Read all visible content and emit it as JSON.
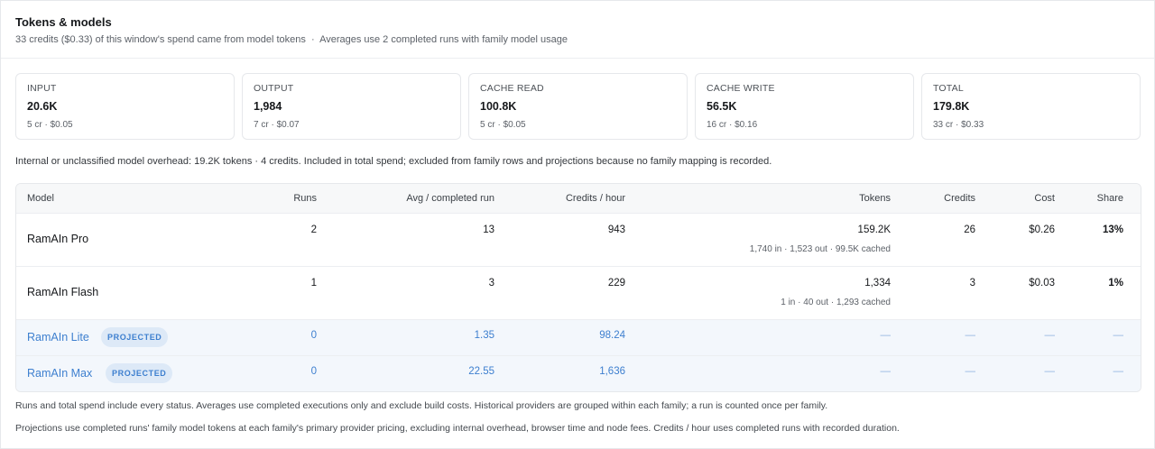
{
  "header": {
    "title": "Tokens & models",
    "subtitle_part1": "33 credits ($0.33) of this window's spend came from model tokens",
    "subtitle_sep": "·",
    "subtitle_part2": "Averages use 2 completed runs with family model usage"
  },
  "stats": [
    {
      "label": "INPUT",
      "value": "20.6K",
      "credits": "5 cr",
      "cost": "$0.05"
    },
    {
      "label": "OUTPUT",
      "value": "1,984",
      "credits": "7 cr",
      "cost": "$0.07"
    },
    {
      "label": "CACHE READ",
      "value": "100.8K",
      "credits": "5 cr",
      "cost": "$0.05"
    },
    {
      "label": "CACHE WRITE",
      "value": "56.5K",
      "credits": "16 cr",
      "cost": "$0.16"
    },
    {
      "label": "TOTAL",
      "value": "179.8K",
      "credits": "33 cr",
      "cost": "$0.33"
    }
  ],
  "overhead_note": "Internal or unclassified model overhead: 19.2K tokens · 4 credits. Included in total spend; excluded from family rows and projections because no family mapping is recorded.",
  "table": {
    "columns": {
      "model": "Model",
      "runs": "Runs",
      "avg": "Avg / completed run",
      "cph": "Credits / hour",
      "tokens": "Tokens",
      "credits": "Credits",
      "cost": "Cost",
      "share": "Share"
    },
    "rows": [
      {
        "model": "RamAIn Pro",
        "runs": "2",
        "avg": "13",
        "cph": "943",
        "tokens": "159.2K",
        "tokens_detail": "1,740 in · 1,523 out · 99.5K cached",
        "credits": "26",
        "cost": "$0.26",
        "share": "13%"
      },
      {
        "model": "RamAIn Flash",
        "runs": "1",
        "avg": "3",
        "cph": "229",
        "tokens": "1,334",
        "tokens_detail": "1 in · 40 out · 1,293 cached",
        "credits": "3",
        "cost": "$0.03",
        "share": "1%"
      }
    ],
    "projected": [
      {
        "model": "RamAIn Lite",
        "badge": "PROJECTED",
        "runs": "0",
        "avg": "1.35",
        "cph": "98.24",
        "tokens": "—",
        "credits": "—",
        "cost": "—",
        "share": "—"
      },
      {
        "model": "RamAIn Max",
        "badge": "PROJECTED",
        "runs": "0",
        "avg": "22.55",
        "cph": "1,636",
        "tokens": "—",
        "credits": "—",
        "cost": "—",
        "share": "—"
      }
    ]
  },
  "footnotes": [
    "Runs and total spend include every status. Averages use completed executions only and exclude build costs. Historical providers are grouped within each family; a run is counted once per family.",
    "Projections use completed runs' family model tokens at each family's primary provider pricing, excluding internal overhead, browser time and node fees. Credits / hour uses completed runs with recorded duration."
  ]
}
